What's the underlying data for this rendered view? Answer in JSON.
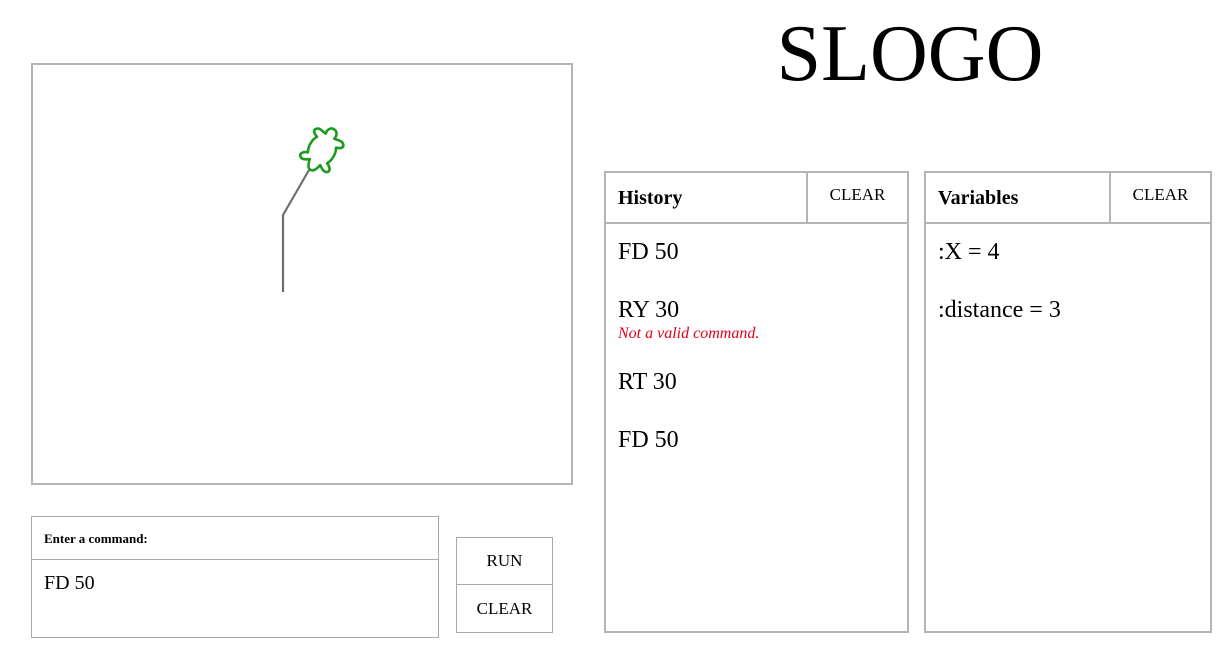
{
  "app": {
    "title": "SLOGO"
  },
  "canvas": {
    "turtle_color": "#1e9a1e",
    "trail_color": "#6e6e6e"
  },
  "command": {
    "label": "Enter a command:",
    "value": "FD 50",
    "run_label": "RUN",
    "clear_label": "CLEAR"
  },
  "history": {
    "title": "History",
    "clear_label": "CLEAR",
    "items": [
      {
        "text": "FD 50"
      },
      {
        "text": "RY 30",
        "error": "Not a valid command."
      },
      {
        "text": "RT 30"
      },
      {
        "text": "FD 50"
      }
    ]
  },
  "variables": {
    "title": "Variables",
    "clear_label": "CLEAR",
    "items": [
      {
        "text": ":X = 4"
      },
      {
        "text": ":distance = 3"
      }
    ]
  },
  "colors": {
    "error": "#e2001a",
    "border": "#b4b4b4"
  }
}
